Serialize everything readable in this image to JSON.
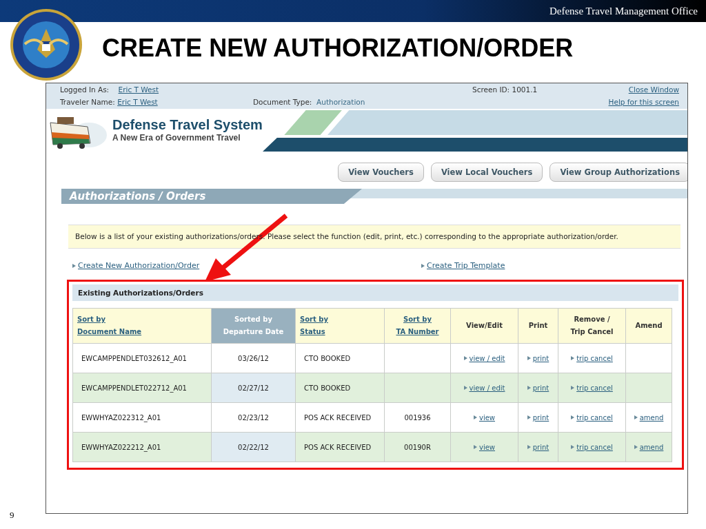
{
  "slide": {
    "header_org": "Defense Travel Management Office",
    "title": "CREATE NEW AUTHORIZATION/ORDER",
    "page_number": "9"
  },
  "app": {
    "info": {
      "logged_in_label": "Logged In As:",
      "logged_in_value": "Eric T West",
      "traveler_label": "Traveler Name:",
      "traveler_value": "Eric T West",
      "doc_type_label": "Document Type:",
      "doc_type_value": "Authorization",
      "screen_id": "Screen ID: 1001.1",
      "close_link": "Close Window",
      "help_link": "Help for this screen"
    },
    "brand": {
      "name": "Defense Travel System",
      "tagline": "A New Era of Government Travel"
    },
    "buttons": [
      "View Vouchers",
      "View Local Vouchers",
      "View Group Authorizations"
    ],
    "section_title": "Authorizations / Orders",
    "notice": "Below is a list of your existing authorizations/orders. Please select the function (edit, print, etc.) corresponding to the appropriate authorization/order.",
    "links": [
      "Create New Authorization/Order",
      "Create Trip Template"
    ],
    "table": {
      "title": "Existing Authorizations/Orders",
      "columns": [
        {
          "kind": "sort_link",
          "lines": [
            "Sort by",
            "Document Name"
          ]
        },
        {
          "kind": "sorted",
          "lines": [
            "Sorted by",
            "Departure Date"
          ]
        },
        {
          "kind": "sort_link",
          "lines": [
            "Sort by",
            "Status"
          ]
        },
        {
          "kind": "sort_link",
          "lines": [
            "Sort by",
            "TA Number"
          ]
        },
        {
          "kind": "plain",
          "lines": [
            "View/Edit"
          ]
        },
        {
          "kind": "plain",
          "lines": [
            "Print"
          ]
        },
        {
          "kind": "plain",
          "lines": [
            "Remove /",
            "Trip Cancel"
          ]
        },
        {
          "kind": "plain",
          "lines": [
            "Amend"
          ]
        }
      ],
      "rows": [
        {
          "cells": [
            {
              "kind": "text",
              "text": "EWCAMPPENDLET032612_A01"
            },
            {
              "kind": "text",
              "text": "03/26/12"
            },
            {
              "kind": "text",
              "text": "CTO BOOKED"
            },
            {
              "kind": "blank"
            },
            {
              "kind": "link",
              "text": "view / edit"
            },
            {
              "kind": "link",
              "text": "print"
            },
            {
              "kind": "link",
              "text": "trip cancel"
            },
            {
              "kind": "blank"
            }
          ]
        },
        {
          "cells": [
            {
              "kind": "text",
              "text": "EWCAMPPENDLET022712_A01"
            },
            {
              "kind": "text",
              "text": "02/27/12"
            },
            {
              "kind": "text",
              "text": "CTO BOOKED"
            },
            {
              "kind": "blank"
            },
            {
              "kind": "link",
              "text": "view / edit"
            },
            {
              "kind": "link",
              "text": "print"
            },
            {
              "kind": "link",
              "text": "trip cancel"
            },
            {
              "kind": "blank"
            }
          ]
        },
        {
          "cells": [
            {
              "kind": "text",
              "text": "EWWHYAZ022312_A01"
            },
            {
              "kind": "text",
              "text": "02/23/12"
            },
            {
              "kind": "text",
              "text": "POS ACK RECEIVED"
            },
            {
              "kind": "text",
              "text": "001936"
            },
            {
              "kind": "link",
              "text": "view"
            },
            {
              "kind": "link",
              "text": "print"
            },
            {
              "kind": "link",
              "text": "trip cancel"
            },
            {
              "kind": "link",
              "text": "amend"
            }
          ]
        },
        {
          "cells": [
            {
              "kind": "text",
              "text": "EWWHYAZ022212_A01"
            },
            {
              "kind": "text",
              "text": "02/22/12"
            },
            {
              "kind": "text",
              "text": "POS ACK RECEIVED"
            },
            {
              "kind": "text",
              "text": "00190R"
            },
            {
              "kind": "link",
              "text": "view"
            },
            {
              "kind": "link",
              "text": "print"
            },
            {
              "kind": "link",
              "text": "trip cancel"
            },
            {
              "kind": "link",
              "text": "amend"
            }
          ]
        }
      ]
    }
  }
}
